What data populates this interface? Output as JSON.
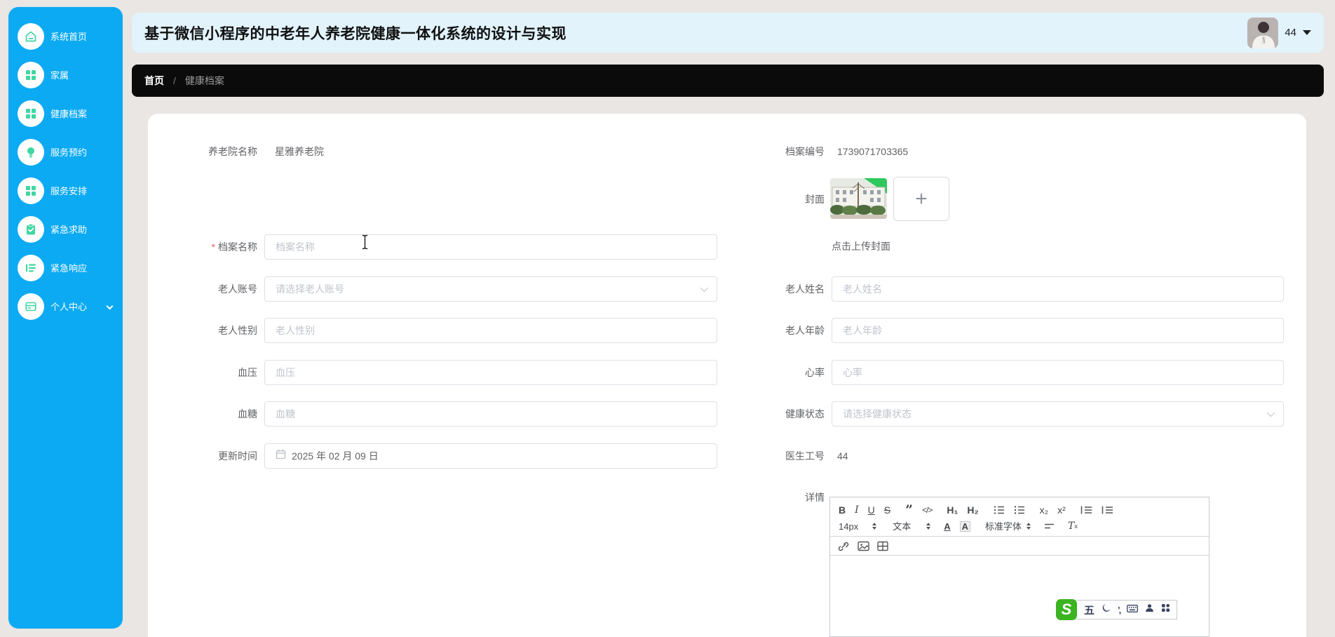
{
  "app": {
    "title": "基于微信小程序的中老年人养老院健康一体化系统的设计与实现",
    "user": "44"
  },
  "sidebar": {
    "items": [
      {
        "label": "系统首页",
        "icon": "home-icon"
      },
      {
        "label": "家属",
        "icon": "grid-icon"
      },
      {
        "label": "健康档案",
        "icon": "grid-icon"
      },
      {
        "label": "服务预约",
        "icon": "bulb-icon"
      },
      {
        "label": "服务安排",
        "icon": "grid-icon"
      },
      {
        "label": "紧急求助",
        "icon": "clipboard-check-icon"
      },
      {
        "label": "紧急响应",
        "icon": "list-icon"
      },
      {
        "label": "个人中心",
        "icon": "card-icon"
      }
    ]
  },
  "breadcrumb": {
    "home": "首页",
    "separator": "/",
    "current": "健康档案"
  },
  "form": {
    "nursing_home": {
      "label": "养老院名称",
      "value": "星雅养老院"
    },
    "archive_no": {
      "label": "档案编号",
      "value": "1739071703365"
    },
    "cover": {
      "label": "封面",
      "hint": "点击上传封面"
    },
    "archive_name": {
      "label": "档案名称",
      "placeholder": "档案名称"
    },
    "elder_account": {
      "label": "老人账号",
      "placeholder": "请选择老人账号"
    },
    "elder_name": {
      "label": "老人姓名",
      "placeholder": "老人姓名"
    },
    "elder_gender": {
      "label": "老人性别",
      "placeholder": "老人性别"
    },
    "elder_age": {
      "label": "老人年龄",
      "placeholder": "老人年龄"
    },
    "blood_pressure": {
      "label": "血压",
      "placeholder": "血压"
    },
    "heart_rate": {
      "label": "心率",
      "placeholder": "心率"
    },
    "blood_sugar": {
      "label": "血糖",
      "placeholder": "血糖"
    },
    "health_status": {
      "label": "健康状态",
      "placeholder": "请选择健康状态"
    },
    "update_time": {
      "label": "更新时间",
      "value": "2025 年 02 月 09 日"
    },
    "doctor_no": {
      "label": "医生工号",
      "value": "44"
    },
    "detail": {
      "label": "详情"
    }
  },
  "editor": {
    "toolbar": {
      "bold": "B",
      "italic": "I",
      "underline": "U",
      "strike": "S",
      "blockquote": "”",
      "code": "</>",
      "h1": "H₁",
      "h2": "H₂",
      "subscript": "x₂",
      "superscript": "x²",
      "size": "14px",
      "format": "文本",
      "color": "A",
      "background": "A",
      "font": "标准字体",
      "clear_prefix": "T",
      "clear_suffix": "x"
    }
  },
  "ime": {
    "brand": "S",
    "wubi": "五"
  },
  "colors": {
    "sidebar_blue": "#0caaf2",
    "icon_green": "#3fd6a0",
    "topbar_bg": "#e2f3fc",
    "breadcrumb_bg": "#0b0b0b",
    "page_bg": "#e9e6e3",
    "required_red": "#f45b5b",
    "sogou_green": "#3cb422"
  }
}
